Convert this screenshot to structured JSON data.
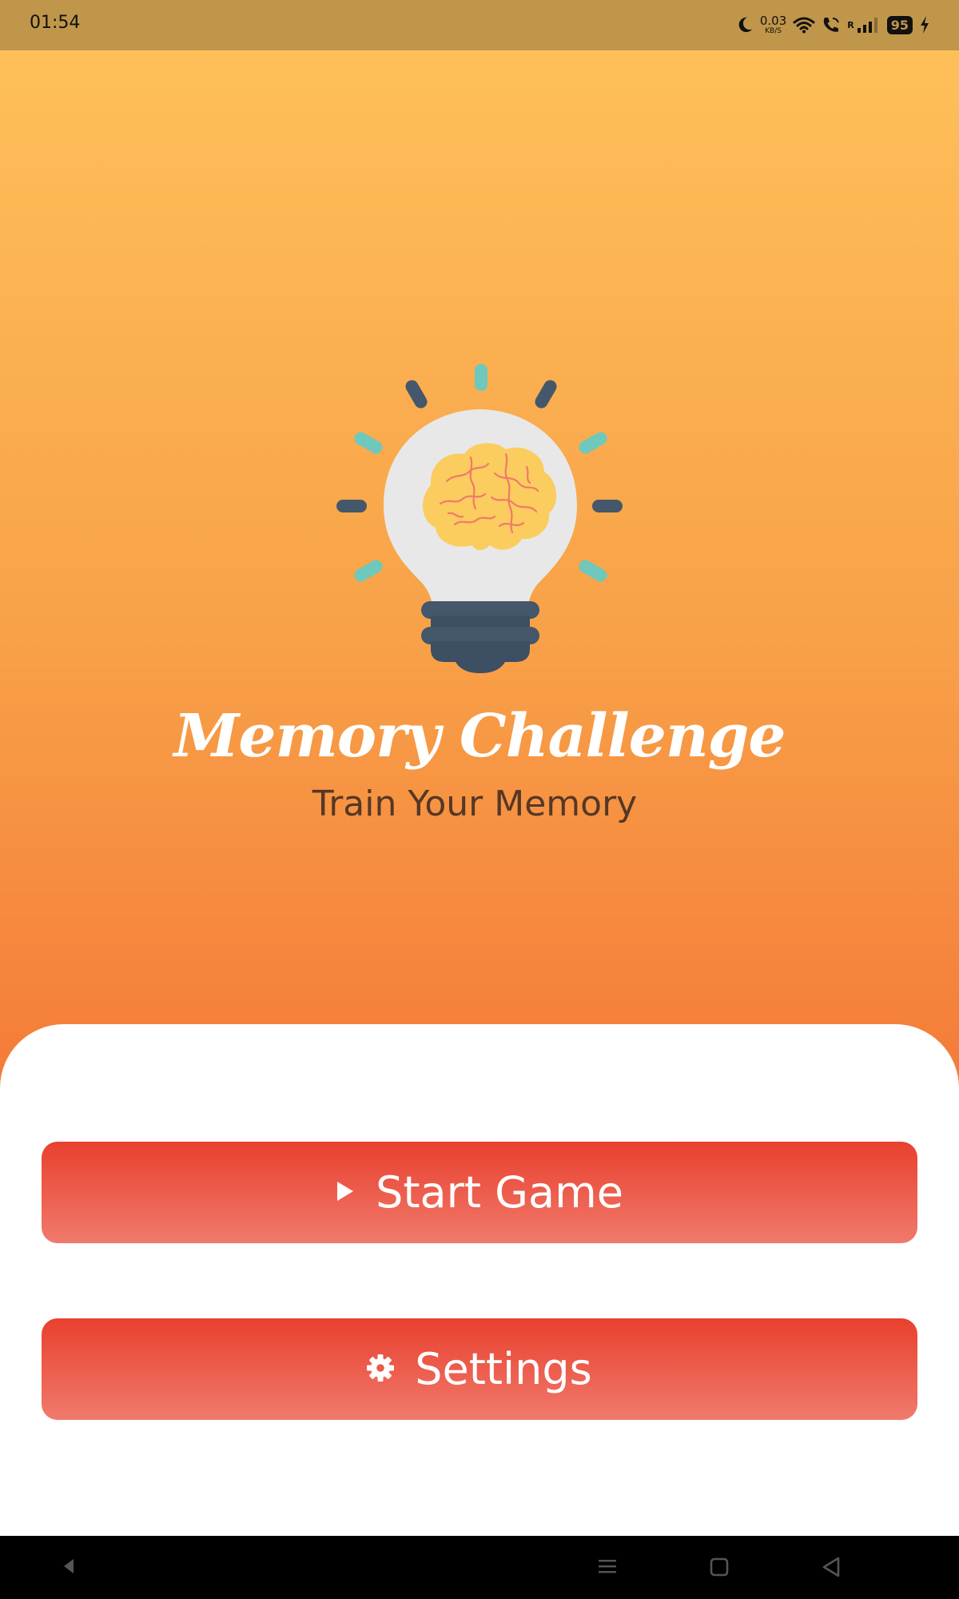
{
  "status_bar": {
    "time": "01:54",
    "net_speed_value": "0.03",
    "net_speed_unit": "KB/S",
    "signal_label": "R",
    "battery": "95",
    "icons": [
      "moon-icon",
      "wifi-icon",
      "wifi-call-icon",
      "signal-icon",
      "charging-icon"
    ]
  },
  "app": {
    "title": "Memory Challenge",
    "subtitle": "Train Your Memory",
    "logo_icon": "lightbulb-brain-icon"
  },
  "menu": {
    "start_label": "Start Game",
    "start_icon": "play-icon",
    "settings_label": "Settings",
    "settings_icon": "gear-icon"
  },
  "nav_bar": {
    "icons": [
      "back-arrow-icon",
      "menu-icon",
      "home-icon",
      "back-icon"
    ]
  },
  "colors": {
    "gradient_top": "#ffc25a",
    "gradient_bottom": "#f27034",
    "status_bar": "#c0964a",
    "button_top": "#e9402e",
    "button_bottom": "#f07a6c",
    "subtitle": "#553826"
  }
}
